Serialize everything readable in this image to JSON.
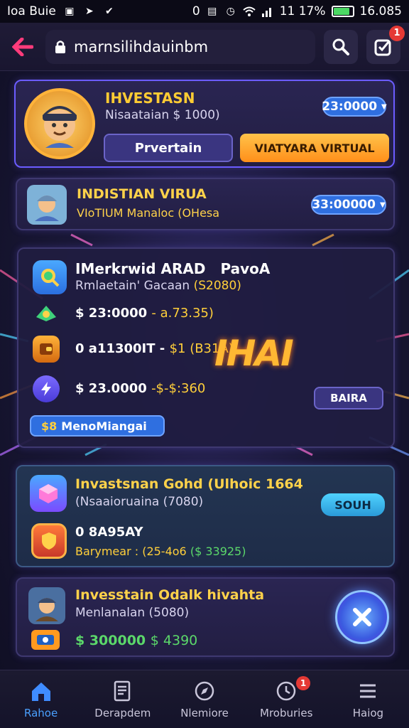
{
  "status_bar": {
    "carrier": "Ioa Buie",
    "time": "16.085",
    "battery_text": "11 17%",
    "left_small": "0"
  },
  "url_bar": {
    "url": "marnsilihdauinbm",
    "notification_count": "1"
  },
  "card1": {
    "title": "IHVESTASN",
    "subtitle": "Nisaataian $ 1000)",
    "amount": "23:0000",
    "btn_left": "Prvertain",
    "btn_right": "VIATYARA VIRTUAL"
  },
  "card2": {
    "title": "INDISTIAN VIRUA",
    "subtitle": "VIoTIUM Manaloc (OHesa",
    "amount": "33:00000"
  },
  "card3": {
    "title_part1": "IMerkrwid ARAD",
    "title_part2": "PavoA",
    "subtitle_prefix": "Rmlaetain' Gacaan",
    "subtitle_value": "(S2080)",
    "rows": [
      {
        "main": "$ 23:0000",
        "detail": "- a.73.35)"
      },
      {
        "main": "0 a11300IT -",
        "detail": "$1 (B31A)"
      },
      {
        "main": "$ 23.0000",
        "detail": "-$-$:360"
      }
    ],
    "big_badge": "IHAI",
    "side_button": "BAIRA",
    "footer_pill_prefix": "$8",
    "footer_pill": "MenoMiangai"
  },
  "card4": {
    "title": "Invastsnan Gohd (Ulhoic 1664",
    "subtitle": "(Nsaaioruaina (7080)",
    "button": "SOUH",
    "row_main": "0 8A95AY",
    "row_detail_label": "Barymear : (25-4o6",
    "row_detail_value": "($ 33925)"
  },
  "card5": {
    "title": "Invesstain Odalk hivahta",
    "subtitle": "Menlanalan (5080)",
    "amount_main": "$ 300000",
    "amount_detail": "$ 4390"
  },
  "bottom_nav": [
    {
      "label": "Rahoe",
      "icon": "home-icon"
    },
    {
      "label": "Derapdem",
      "icon": "document-icon"
    },
    {
      "label": "Nlemiore",
      "icon": "compass-icon"
    },
    {
      "label": "Mroburies",
      "icon": "clock-icon",
      "badge": "1"
    },
    {
      "label": "Haiog",
      "icon": "menu-icon"
    }
  ],
  "colors": {
    "accent_blue": "#2f6fe0",
    "accent_gold": "#ffcc33",
    "accent_orange": "#ff9a1f",
    "green": "#5bd86a",
    "alert_red": "#e53935"
  }
}
